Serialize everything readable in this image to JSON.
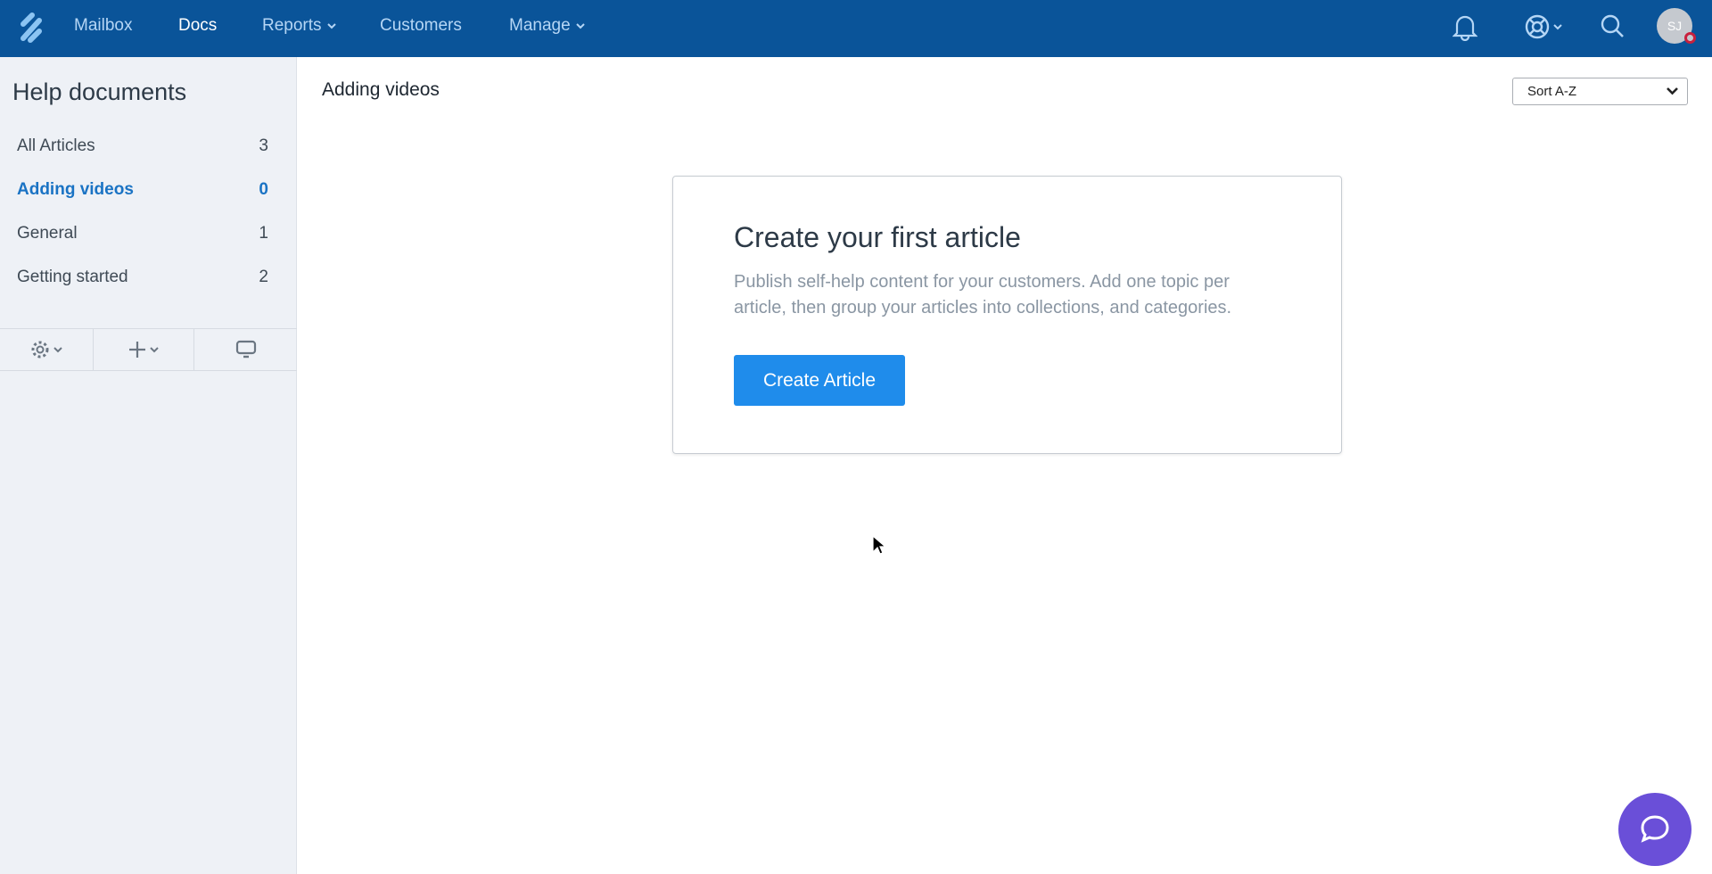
{
  "nav": {
    "items": [
      {
        "label": "Mailbox"
      },
      {
        "label": "Docs",
        "active": true
      },
      {
        "label": "Reports",
        "dropdown": true
      },
      {
        "label": "Customers"
      },
      {
        "label": "Manage",
        "dropdown": true
      }
    ],
    "avatar_initials": "SJ",
    "brand_color": "#0a5499"
  },
  "sidebar": {
    "title": "Help documents",
    "items": [
      {
        "label": "All Articles",
        "count": "3"
      },
      {
        "label": "Adding videos",
        "count": "0",
        "active": true
      },
      {
        "label": "General",
        "count": "1"
      },
      {
        "label": "Getting started",
        "count": "2"
      }
    ],
    "tools": [
      "gear-icon",
      "plus-icon",
      "monitor-icon"
    ]
  },
  "main": {
    "title": "Adding videos",
    "sort": "Sort A-Z",
    "card": {
      "title": "Create your first article",
      "description": "Publish self-help content for your customers. Add one topic per article, then group your articles into collections, and categories.",
      "button": "Create Article"
    }
  },
  "colors": {
    "accent": "#1f8ceb",
    "chat": "#6a4fd8"
  }
}
